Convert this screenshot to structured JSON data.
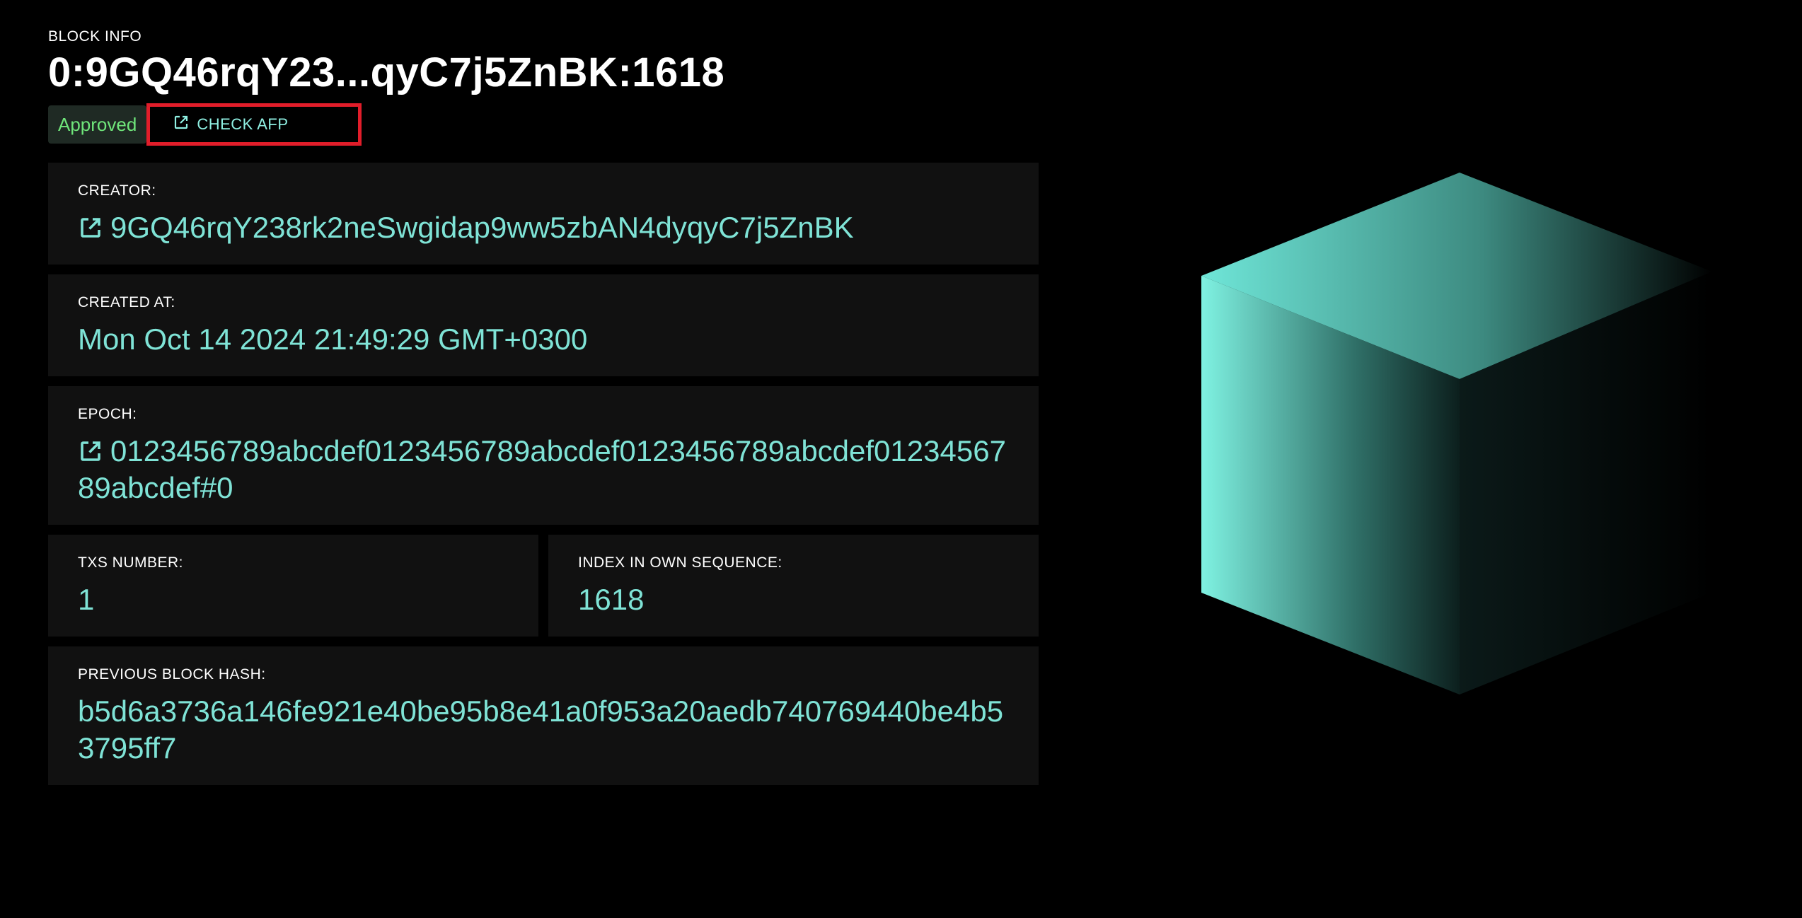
{
  "header": {
    "eyebrow": "BLOCK INFO",
    "title": "0:9GQ46rqY23...qyC7j5ZnBK:1618",
    "status_badge": "Approved",
    "check_afp_label": "CHECK AFP"
  },
  "creator": {
    "label": "CREATOR:",
    "value": "9GQ46rqY238rk2neSwgidap9ww5zbAN4dyqyC7j5ZnBK",
    "icon": "external-link-icon"
  },
  "created_at": {
    "label": "CREATED AT:",
    "value": "Mon Oct 14 2024 21:49:29 GMT+0300"
  },
  "epoch": {
    "label": "EPOCH:",
    "value": "0123456789abcdef0123456789abcdef0123456789abcdef0123456789abcdef#0",
    "icon": "external-link-icon"
  },
  "txs_number": {
    "label": "TXS NUMBER:",
    "value": "1"
  },
  "index_in_sequence": {
    "label": "INDEX IN OWN SEQUENCE:",
    "value": "1618"
  },
  "previous_block_hash": {
    "label": "PREVIOUS BLOCK HASH:",
    "value": "b5d6a3736a146fe921e40be95b8e41a0f953a20aedb740769440be4b53795ff7"
  },
  "colors": {
    "background": "#000000",
    "card": "#111111",
    "accent": "#7fe3d6",
    "approved": "#6fe57a",
    "highlight_border": "#e11d2a"
  },
  "illustration": {
    "icon": "cube-illustration"
  }
}
